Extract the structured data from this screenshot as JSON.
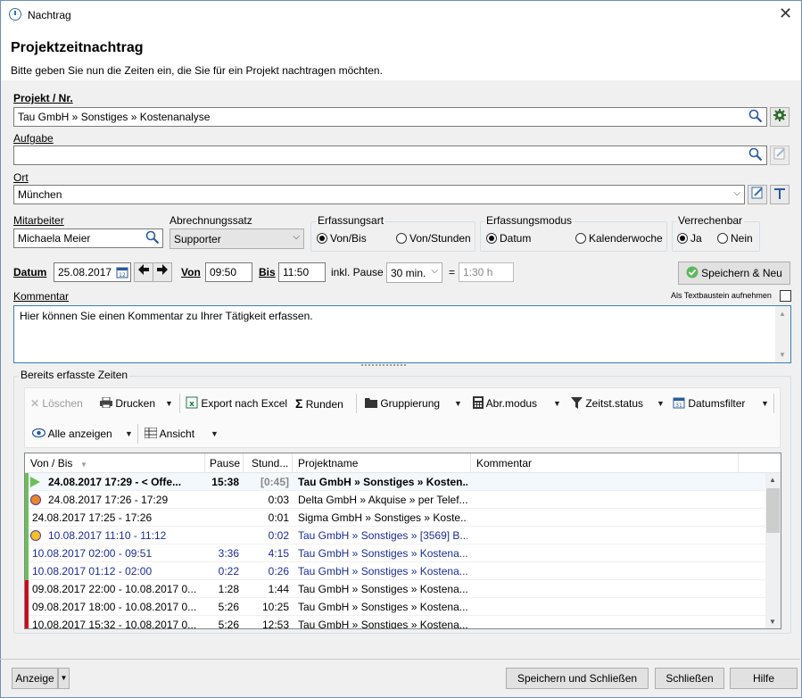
{
  "window": {
    "title": "Nachtrag",
    "close_label": "✕"
  },
  "header": {
    "title": "Projektzeitnachtrag",
    "subtitle": "Bitte geben Sie nun die Zeiten ein, die Sie für ein Projekt nachtragen möchten."
  },
  "form": {
    "projekt_label": "Projekt / Nr.",
    "projekt_value": "Tau GmbH » Sonstiges » Kostenanalyse",
    "aufgabe_label": "Aufgabe",
    "aufgabe_value": "",
    "ort_label": "Ort",
    "ort_value": "München",
    "mitarbeiter_label": "Mitarbeiter",
    "mitarbeiter_value": "Michaela Meier",
    "abrechnungssatz_label": "Abrechnungssatz",
    "abrechnungssatz_value": "Supporter",
    "erfassungsart": {
      "title": "Erfassungsart",
      "option1": "Von/Bis",
      "option2": "Von/Stunden"
    },
    "erfassungsmodus": {
      "title": "Erfassungsmodus",
      "option1": "Datum",
      "option2": "Kalenderwoche"
    },
    "verrechenbar": {
      "title": "Verrechenbar",
      "option1": "Ja",
      "option2": "Nein"
    },
    "datum_label": "Datum",
    "datum_value": "25.08.2017",
    "von_label": "Von",
    "von_value": "09:50",
    "bis_label": "Bis",
    "bis_value": "11:50",
    "pause_label": "inkl. Pause",
    "pause_value": "30 min.",
    "equals": "=",
    "duration_value": "1:30 h",
    "save_new_label": "Speichern & Neu",
    "kommentar_label": "Kommentar",
    "textbaustein_label": "Als Textbaustein aufnehmen",
    "kommentar_value": "Hier können Sie einen Kommentar zu Ihrer Tätigkeit erfassen."
  },
  "erfasste": {
    "title": "Bereits erfasste Zeiten",
    "toolbar": {
      "loeschen": "Löschen",
      "drucken": "Drucken",
      "export": "Export nach Excel",
      "runden": "Runden",
      "gruppierung": "Gruppierung",
      "abrmodus": "Abr.modus",
      "zeitststatus": "Zeitst.status",
      "datumsfilter": "Datumsfilter",
      "alle_anzeigen": "Alle anzeigen",
      "ansicht": "Ansicht"
    },
    "columns": [
      "Von / Bis",
      "Pause",
      "Stund...",
      "Projektname",
      "Kommentar"
    ],
    "rows": [
      {
        "vonbis": "24.08.2017   17:29 - < Offe...",
        "pause": "15:38",
        "stunden": "[0:45]",
        "projekt": "Tau GmbH » Sonstiges » Kosten...",
        "color": "#000000",
        "marker": "#6bbf59"
      },
      {
        "vonbis": "24.08.2017   17:26 - 17:29",
        "pause": "",
        "stunden": "0:03",
        "projekt": "Delta GmbH » Akquise » per Telef...",
        "color": "#000000",
        "marker": "#6bbf59"
      },
      {
        "vonbis": "24.08.2017   17:25 - 17:26",
        "pause": "",
        "stunden": "0:01",
        "projekt": "Sigma GmbH » Sonstiges » Koste...",
        "color": "#000000",
        "marker": "#6bbf59"
      },
      {
        "vonbis": "10.08.2017   11:10 - 11:12",
        "pause": "",
        "stunden": "0:02",
        "projekt": "Tau GmbH » Sonstiges » [3569] B...",
        "color": "#1a2d8f",
        "marker": "#6bbf59"
      },
      {
        "vonbis": "10.08.2017   02:00 - 09:51",
        "pause": "3:36",
        "stunden": "4:15",
        "projekt": "Tau GmbH » Sonstiges » Kostena...",
        "color": "#1a2d8f",
        "marker": "#6bbf59"
      },
      {
        "vonbis": "10.08.2017   01:12 - 02:00",
        "pause": "0:22",
        "stunden": "0:26",
        "projekt": "Tau GmbH » Sonstiges » Kostena...",
        "color": "#1a2d8f",
        "marker": "#6bbf59"
      },
      {
        "vonbis": "09.08.2017   22:00 - 10.08.2017 0...",
        "pause": "1:28",
        "stunden": "1:44",
        "projekt": "Tau GmbH » Sonstiges » Kostena...",
        "color": "#000000",
        "marker": "#d0021b"
      },
      {
        "vonbis": "09.08.2017   18:00 - 10.08.2017 0...",
        "pause": "5:26",
        "stunden": "10:25",
        "projekt": "Tau GmbH » Sonstiges » Kostena...",
        "color": "#000000",
        "marker": "#d0021b"
      },
      {
        "vonbis": "10.08.2017   15:32 - 10.08.2017 0...",
        "pause": "5:26",
        "stunden": "12:53",
        "projekt": "Tau GmbH » Sonstiges » Kostena...",
        "color": "#000000",
        "marker": "#d0021b"
      }
    ]
  },
  "footer": {
    "anzeige": "Anzeige",
    "speichern_schliessen": "Speichern und Schließen",
    "schliessen": "Schließen",
    "hilfe": "Hilfe"
  }
}
